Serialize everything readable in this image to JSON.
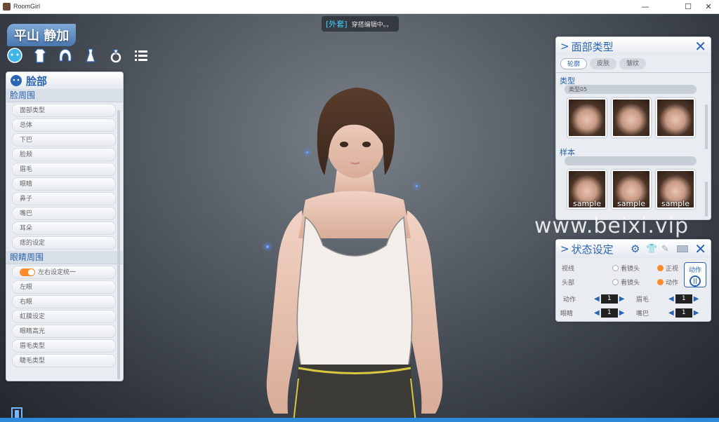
{
  "window": {
    "title": "RoomGirl",
    "min": "—",
    "max": "☐",
    "close": "✕"
  },
  "toast": {
    "tag": "[外套]",
    "text": "穿搭编辑中。。"
  },
  "character": {
    "name": "平山 静加"
  },
  "top_icons": [
    "face-icon",
    "body-icon",
    "hair-icon",
    "clothes-icon",
    "accessory-icon",
    "list-icon"
  ],
  "face_panel": {
    "title": "脸部",
    "sections": [
      {
        "header": "脸周围",
        "items": [
          "面部类型",
          "总体",
          "下巴",
          "脸颊",
          "眉毛",
          "眼睛",
          "鼻子",
          "嘴巴",
          "耳朵",
          "痣的设定"
        ]
      },
      {
        "header": "眼睛周围",
        "toggle_item": "左右设定统一",
        "items": [
          "左眼",
          "右眼",
          "虹膜设定",
          "眼睛高光",
          "眉毛类型",
          "睫毛类型"
        ]
      }
    ]
  },
  "facetype_panel": {
    "title": "面部类型",
    "tabs": [
      "轮廓",
      "皮肤",
      "皱纹"
    ],
    "type_label": "类型",
    "type_value": "类型05",
    "sample_label": "样本",
    "sample_value": "",
    "sample_thumb_label": "sample"
  },
  "state_panel": {
    "title": "状态设定",
    "gaze_label": "视线",
    "gaze_opt1": "看镜头",
    "gaze_opt2": "正视",
    "head_label": "头部",
    "head_opt1": "看镜头",
    "head_opt2": "动作",
    "action_btn": "动作",
    "steppers": [
      {
        "label": "动作",
        "value": "1"
      },
      {
        "label": "眉毛",
        "value": "1"
      },
      {
        "label": "眼睛",
        "value": "1"
      },
      {
        "label": "嘴巴",
        "value": "1"
      }
    ]
  },
  "watermark": "www.beixi.vip",
  "colors": {
    "accent": "#2a64b4",
    "orange": "#ff8a2a",
    "panel": "#e9ecf0"
  }
}
